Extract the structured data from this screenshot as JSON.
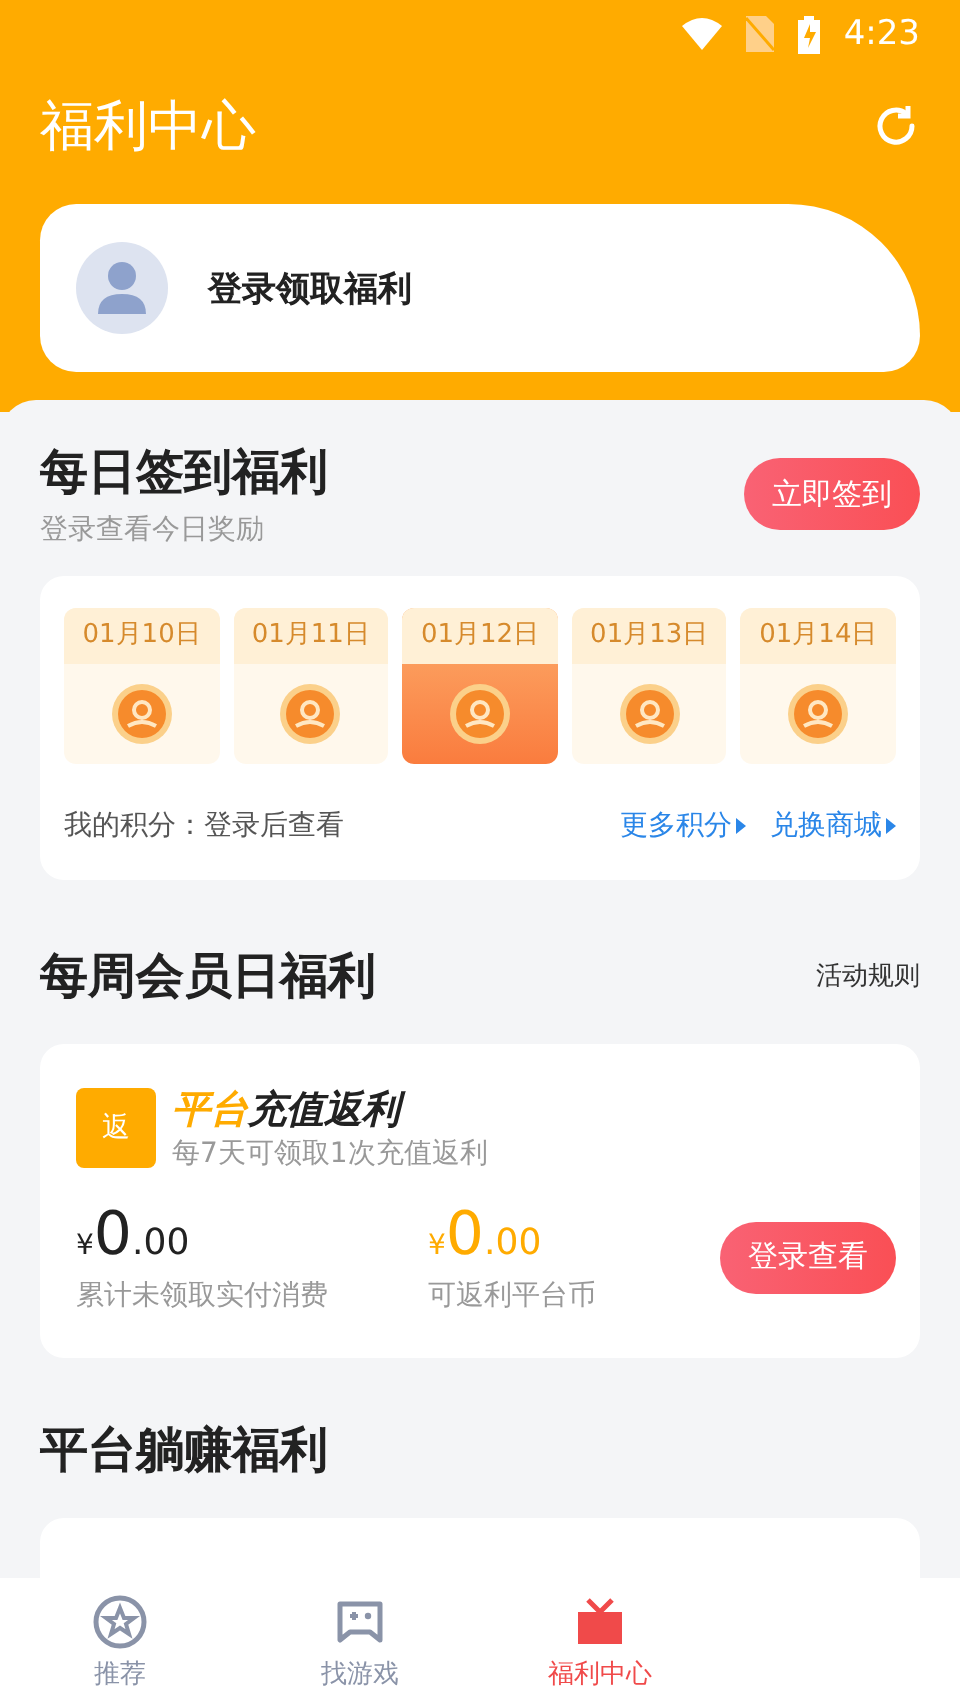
{
  "status_bar": {
    "time": "4:23"
  },
  "header": {
    "title": "福利中心"
  },
  "login_card": {
    "label": "登录领取福利"
  },
  "daily": {
    "title": "每日签到福利",
    "subtitle": "登录查看今日奖励",
    "button": "立即签到",
    "days": [
      {
        "date": "01月10日",
        "selected": false
      },
      {
        "date": "01月11日",
        "selected": false
      },
      {
        "date": "01月12日",
        "selected": true
      },
      {
        "date": "01月13日",
        "selected": false
      },
      {
        "date": "01月14日",
        "selected": false
      }
    ],
    "points_label": "我的积分：登录后查看",
    "links": [
      "更多积分",
      "兑换商城"
    ]
  },
  "weekly": {
    "title": "每周会员日福利",
    "rules_link": "活动规则",
    "badge": "返",
    "card_title_accent": "平台",
    "card_title_rest": "充值返利",
    "card_subtitle": "每7天可领取1次充值返利",
    "stats": [
      {
        "currency": "¥",
        "integer": "0",
        "decimals": ".00",
        "label": "累计未领取实付消费",
        "kind": "dark"
      },
      {
        "currency": "¥",
        "integer": "0",
        "decimals": ".00",
        "label": "可返利平台币",
        "kind": "accent"
      }
    ],
    "button": "登录查看"
  },
  "earn": {
    "title": "平台躺赚福利"
  },
  "tab_bar": [
    {
      "label": "推荐",
      "kind": "star",
      "selected": false
    },
    {
      "label": "找游戏",
      "kind": "gamepad",
      "selected": false
    },
    {
      "label": "福利中心",
      "kind": "gift",
      "selected": true
    }
  ]
}
